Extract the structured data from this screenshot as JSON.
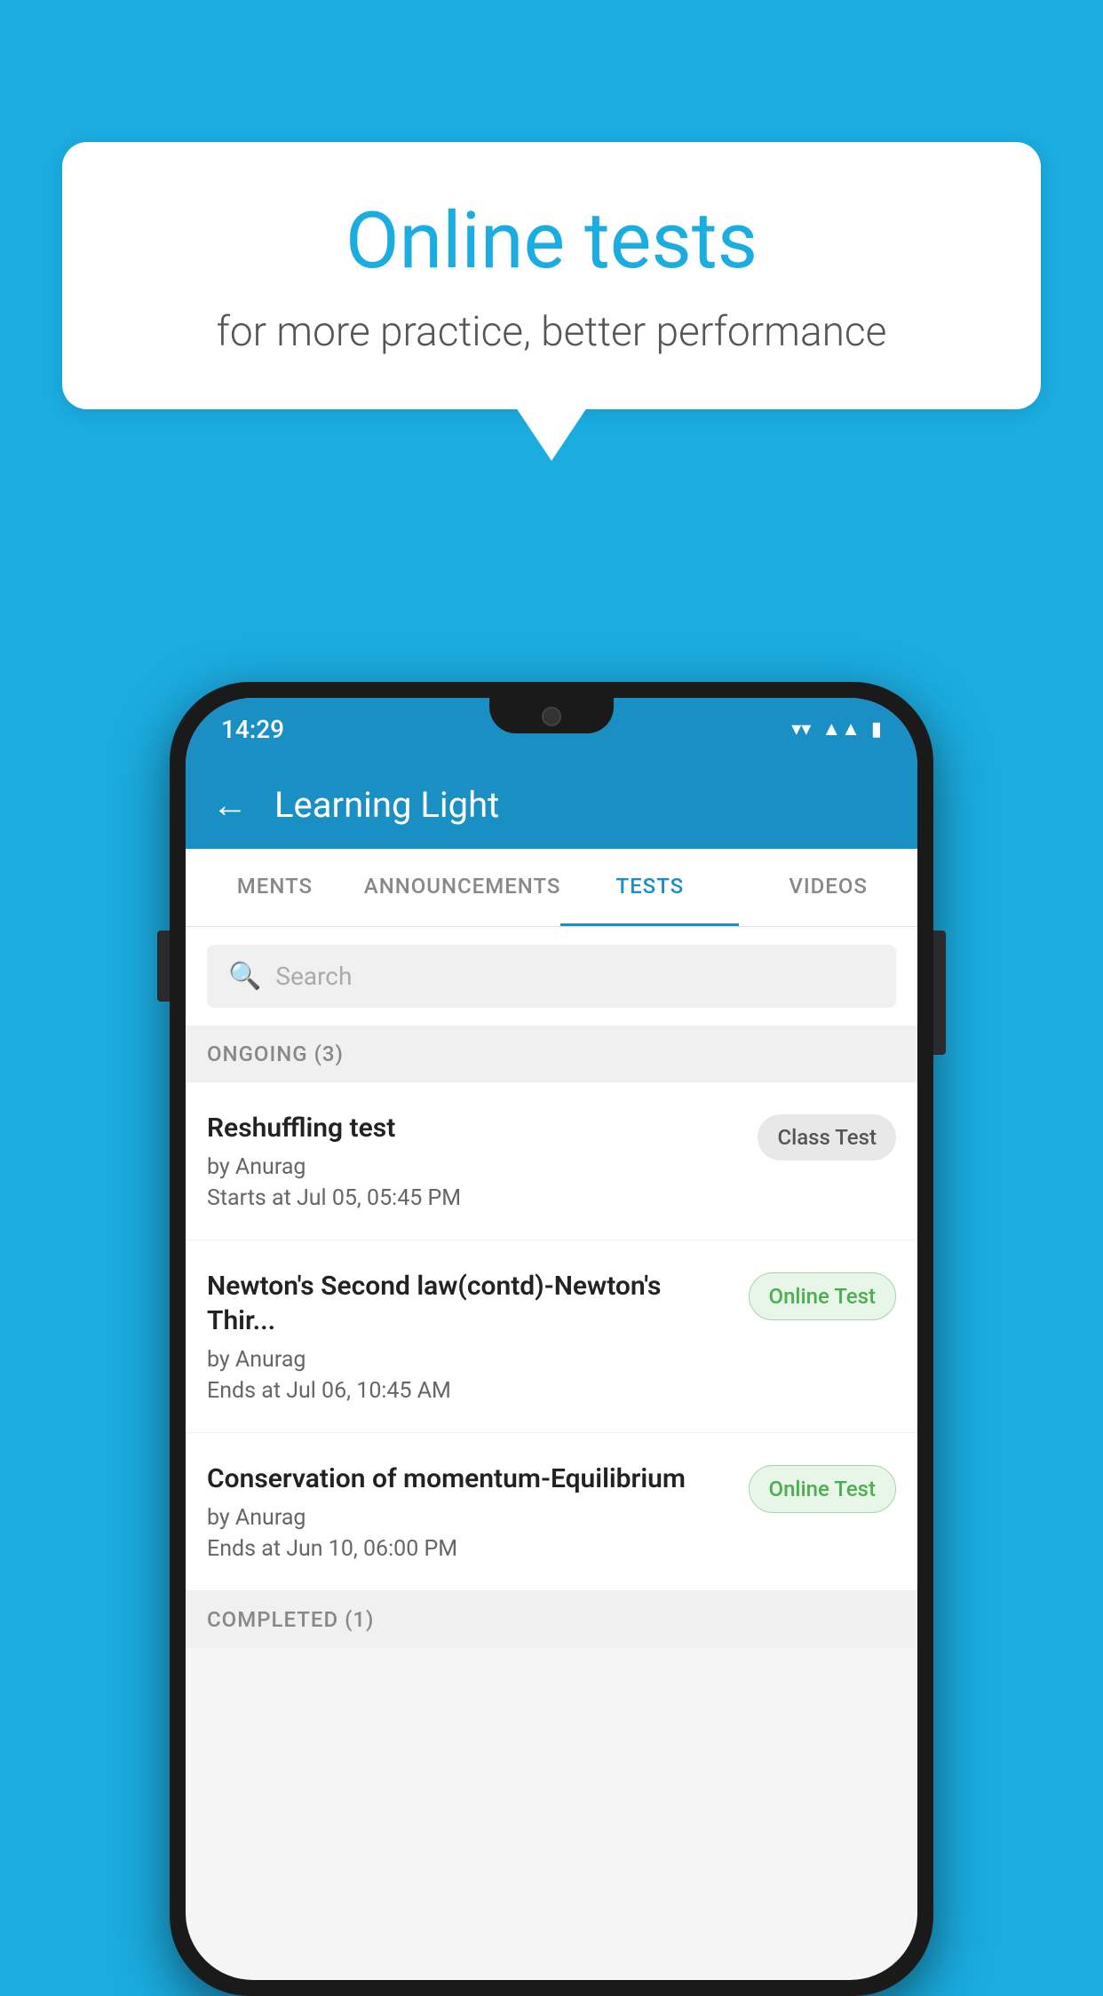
{
  "background_color": "#1BACE0",
  "speech_bubble": {
    "title": "Online tests",
    "subtitle": "for more practice, better performance"
  },
  "phone": {
    "status_bar": {
      "time": "14:29"
    },
    "app_bar": {
      "back_label": "←",
      "title": "Learning Light"
    },
    "tabs": [
      {
        "label": "MENTS",
        "active": false
      },
      {
        "label": "ANNOUNCEMENTS",
        "active": false
      },
      {
        "label": "TESTS",
        "active": true
      },
      {
        "label": "VIDEOS",
        "active": false
      }
    ],
    "search": {
      "placeholder": "Search"
    },
    "ongoing_section": {
      "label": "ONGOING (3)"
    },
    "tests": [
      {
        "title": "Reshuffling test",
        "by": "by Anurag",
        "time_label": "Starts at",
        "time": "Jul 05, 05:45 PM",
        "badge": "Class Test",
        "badge_type": "class"
      },
      {
        "title": "Newton's Second law(contd)-Newton's Thir...",
        "by": "by Anurag",
        "time_label": "Ends at",
        "time": "Jul 06, 10:45 AM",
        "badge": "Online Test",
        "badge_type": "online"
      },
      {
        "title": "Conservation of momentum-Equilibrium",
        "by": "by Anurag",
        "time_label": "Ends at",
        "time": "Jun 10, 06:00 PM",
        "badge": "Online Test",
        "badge_type": "online"
      }
    ],
    "completed_section": {
      "label": "COMPLETED (1)"
    }
  }
}
